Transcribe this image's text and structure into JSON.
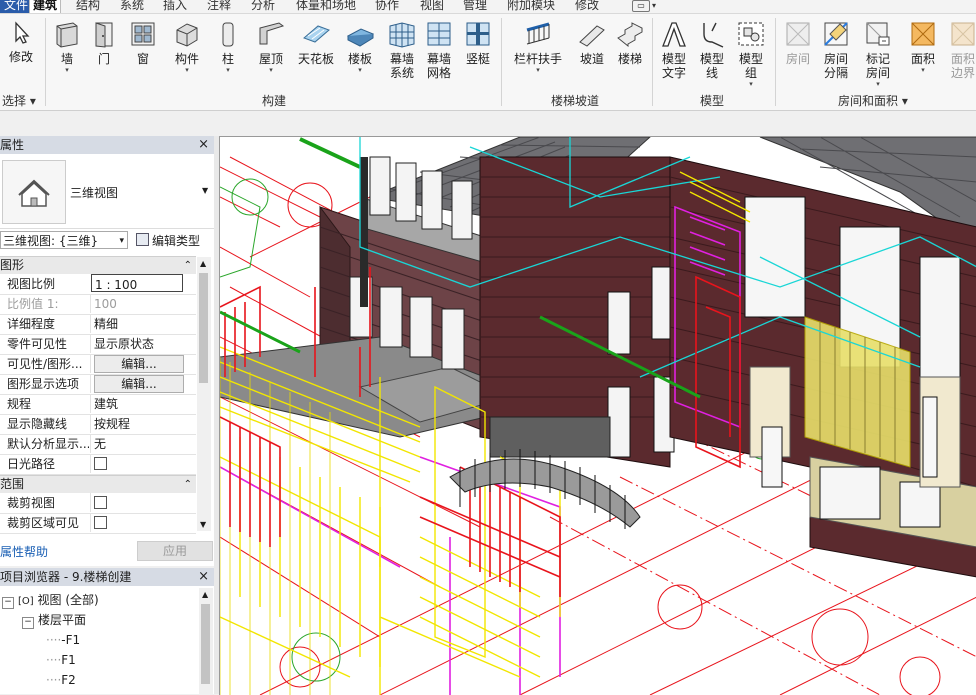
{
  "tabs": [
    "文件",
    "建筑",
    "结构",
    "系统",
    "插入",
    "注释",
    "分析",
    "体量和场地",
    "协作",
    "视图",
    "管理",
    "附加模块",
    "修改"
  ],
  "ribbon": {
    "tools": [
      {
        "id": "modify",
        "label": "修改",
        "icon": "cursor-arrow-icon"
      },
      {
        "id": "wall",
        "label": "墙",
        "icon": "wall-icon",
        "dropdown": true
      },
      {
        "id": "door",
        "label": "门",
        "icon": "door-icon"
      },
      {
        "id": "window",
        "label": "窗",
        "icon": "window-icon"
      },
      {
        "id": "component",
        "label": "构件",
        "icon": "component-icon",
        "dropdown": true
      },
      {
        "id": "column",
        "label": "柱",
        "icon": "column-icon",
        "dropdown": true
      },
      {
        "id": "roof",
        "label": "屋顶",
        "icon": "roof-icon",
        "dropdown": true
      },
      {
        "id": "ceiling",
        "label": "天花板",
        "icon": "ceiling-icon"
      },
      {
        "id": "floor",
        "label": "楼板",
        "icon": "floor-icon",
        "dropdown": true
      },
      {
        "id": "curtain-system",
        "label": "幕墙\n系统",
        "icon": "curtain-system-icon"
      },
      {
        "id": "curtain-grid",
        "label": "幕墙\n网格",
        "icon": "curtain-grid-icon"
      },
      {
        "id": "mullion",
        "label": "竖梃",
        "icon": "mullion-icon"
      },
      {
        "id": "railing",
        "label": "栏杆扶手",
        "icon": "railing-icon",
        "dropdown": true
      },
      {
        "id": "ramp",
        "label": "坡道",
        "icon": "ramp-icon"
      },
      {
        "id": "stair",
        "label": "楼梯",
        "icon": "stair-icon"
      },
      {
        "id": "model-text",
        "label": "模型\n文字",
        "icon": "model-text-icon"
      },
      {
        "id": "model-line",
        "label": "模型\n线",
        "icon": "model-line-icon"
      },
      {
        "id": "model-group",
        "label": "模型\n组",
        "icon": "model-group-icon",
        "dropdown": true
      },
      {
        "id": "room",
        "label": "房间",
        "icon": "room-icon",
        "disabled": true
      },
      {
        "id": "room-separator",
        "label": "房间\n分隔",
        "icon": "room-separator-icon"
      },
      {
        "id": "tag-room",
        "label": "标记\n房间",
        "icon": "tag-room-icon",
        "dropdown": true
      },
      {
        "id": "area",
        "label": "面积",
        "icon": "area-icon",
        "dropdown": true
      },
      {
        "id": "area-boundary",
        "label": "面积\n边界",
        "icon": "area-boundary-icon",
        "disabled": true
      }
    ],
    "groups": {
      "select": "选择",
      "build": "构建",
      "circulation": "楼梯坡道",
      "model": "模型",
      "room_area": "房间和面积"
    }
  },
  "properties": {
    "title": "属性",
    "close": "×",
    "type_name": "三维视图",
    "instance_selector": "三维视图: {三维}",
    "edit_type": "编辑类型",
    "sections": {
      "graphics": "图形",
      "extents": "范围"
    },
    "rows": [
      {
        "k": "视图比例",
        "v": "1 : 100"
      },
      {
        "k": "比例值 1:",
        "v": "100"
      },
      {
        "k": "详细程度",
        "v": "精细"
      },
      {
        "k": "零件可见性",
        "v": "显示原状态"
      },
      {
        "k": "可见性/图形...",
        "v": "编辑..."
      },
      {
        "k": "图形显示选项",
        "v": "编辑..."
      },
      {
        "k": "规程",
        "v": "建筑"
      },
      {
        "k": "显示隐藏线",
        "v": "按规程"
      },
      {
        "k": "默认分析显示...",
        "v": "无"
      },
      {
        "k": "日光路径",
        "v": ""
      },
      {
        "k": "裁剪视图",
        "v": ""
      },
      {
        "k": "裁剪区域可见",
        "v": ""
      }
    ],
    "help": "属性帮助",
    "apply": "应用"
  },
  "browser": {
    "title": "项目浏览器 - 9.楼梯创建",
    "close": "×",
    "views": "视图 (全部)",
    "floor_plans": "楼层平面",
    "levels": [
      "-F1",
      "F1",
      "F2"
    ]
  },
  "colors": {
    "accent": "#2a5caa",
    "panel_header": "#d6dbe4",
    "wall": "#5b2a2e",
    "cad_red": "#e8141c",
    "cad_yellow": "#f2e600",
    "cad_magenta": "#e020e0",
    "cad_cyan": "#19d6d6",
    "cad_green": "#1aa31a"
  }
}
